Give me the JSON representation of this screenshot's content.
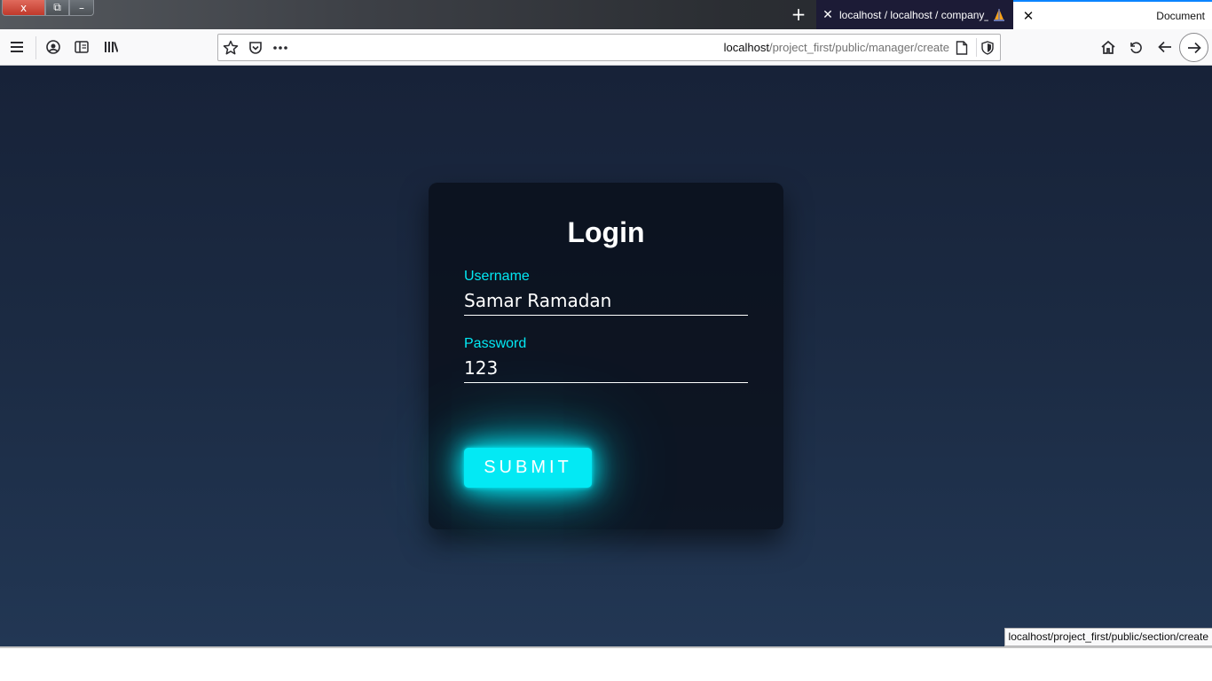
{
  "window": {
    "close_label": "x",
    "restore_label": "⧉",
    "minimize_label": "–"
  },
  "tabs": {
    "new_tab_label": "+",
    "inactive": {
      "title": "localhost / localhost / company_...",
      "close_label": "✕"
    },
    "active": {
      "title": "Document",
      "close_label": "✕"
    }
  },
  "toolbar": {
    "url_host": "localhost",
    "url_path": "/project_first/public/manager/create"
  },
  "login": {
    "title": "Login",
    "username_label": "Username",
    "username_value": "Samar Ramadan",
    "password_label": "Password",
    "password_value": "123",
    "submit_label": "SUBMIT"
  },
  "status": {
    "link_preview": "localhost/project_first/public/section/create"
  },
  "colors": {
    "accent": "#03e9f4",
    "page_bg_top": "#172238",
    "page_bg_bottom": "#223754",
    "card_bg": "#0b111c"
  }
}
